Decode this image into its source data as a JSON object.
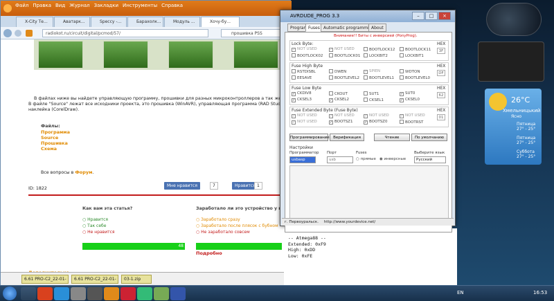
{
  "firefox": {
    "menu": [
      "Файл",
      "Правка",
      "Вид",
      "Журнал",
      "Закладки",
      "Инструменты",
      "Справка"
    ],
    "tabs": [
      "X-City Те...",
      "Аватарк...",
      "Speccy -...",
      "Барахолк...",
      "Модуль ...",
      "Хочу-бу..."
    ],
    "url": "radiokot.ru/circuit/digital/pcmod/57/",
    "search": "прошивка PSS",
    "article": {
      "line1": "В файлах ниже вы найдете управляющую программу, прошивки для разных микроконтроллеров а так же схему у",
      "line2": "В файле \"Source\" лежат все исходники проекта, это прошивка (WinAVR), управляющая программа (RAD Studio XE),",
      "line3": "наклейка (CorelDraw).",
      "files_title": "Файлы:",
      "files": [
        "Программа",
        "Source",
        "Прошивка",
        "Схема"
      ],
      "forum_prefix": "Все вопросы в ",
      "forum_link": "Форум",
      "forum_suffix": ".",
      "id": "ID: 1822",
      "like_label": "Мне нравится",
      "like_count": "7",
      "vk_label": "Нравится",
      "vk_count": "1",
      "poll1_title": "Как вам эта статья?",
      "poll1_options": [
        "Нравится",
        "Так себе",
        "Не нравится"
      ],
      "poll1_result": "48",
      "poll2_title": "Заработало ли это устройство у в",
      "poll2_options": [
        "Заработало сразу",
        "Заработало после плясок с бубном",
        "Не заработало совсем"
      ],
      "poll2_result": "Подробно",
      "more": "Дополнительно"
    },
    "downloads": [
      "6.61 PRO-C2_22-01-2....",
      "6.61 PRO-C2_22-01-2....",
      "03-1.zip"
    ]
  },
  "app": {
    "title": "AVRDUDE_PROG 3.3",
    "tabs": [
      "Program",
      "Fuses",
      "Automatic programming",
      "About"
    ],
    "warning": "Внимание!! Биты с инверсией (PonyProg).",
    "lockbyte": {
      "title": "Lock Byte:",
      "hex": "3F",
      "items": [
        "NOT USED",
        "NOT USED",
        "BOOTLOCK12",
        "BOOTLOCK11",
        "BOOTLOCK02",
        "BOOTLOCK01",
        "LOCKBIT2",
        "LOCKBIT1"
      ]
    },
    "high": {
      "title": "Fuse High Byte",
      "hex": "DF",
      "items": [
        "RSTDISBL",
        "DWEN",
        "SPIEN",
        "WDTON",
        "EESAVE",
        "BOOTLEVEL2",
        "BOOTLEVEL1",
        "BOOTLEVEL0"
      ]
    },
    "low": {
      "title": "Fuse Low Byte",
      "hex": "62",
      "items": [
        "CKDIV8",
        "CKOUT",
        "SUT1",
        "SUT0",
        "CKSEL3",
        "CKSEL2",
        "CKSEL1",
        "CKSEL0"
      ]
    },
    "ext": {
      "title": "Fuse Extended Byte (Fuse Byte)",
      "hex": "01",
      "items": [
        "NOT USED",
        "NOT USED",
        "NOT USED",
        "NOT USED",
        "NOT USED",
        "BOOTSZ1",
        "BOOTSZ0",
        "BOOTRST"
      ]
    },
    "hex_label": "HEX",
    "buttons": [
      "Программирование",
      "Верификация",
      "Чтение",
      "По умолчанию"
    ],
    "settings": {
      "title": "Настройки",
      "programmer_label": "Программатор",
      "programmer": "usbasp",
      "port_label": "Порт",
      "port": "usb",
      "fuses_label": "Fuses",
      "fuses_opt1": "прямые",
      "fuses_opt2": "инверсные",
      "lang_label": "Выберите язык",
      "lang": "Русский"
    },
    "status_left": "г. Первоуральск.",
    "status_right": "http://www.yourdevice.net/"
  },
  "console": [
    "-- Atmega88 --",
    "Extended: 0xF9",
    "High:    0xDD",
    "Low:     0xFE"
  ],
  "weather": {
    "temp": "26°C",
    "city": "Хмельницький",
    "cond": "Ясно",
    "days": [
      {
        "d": "Пятница",
        "t": "27° - 25°"
      },
      {
        "d": "Пятница",
        "t": "27° - 25°"
      },
      {
        "d": "Суббота",
        "t": "27° - 25°"
      }
    ]
  },
  "clock": "16:53",
  "lang": "EN"
}
